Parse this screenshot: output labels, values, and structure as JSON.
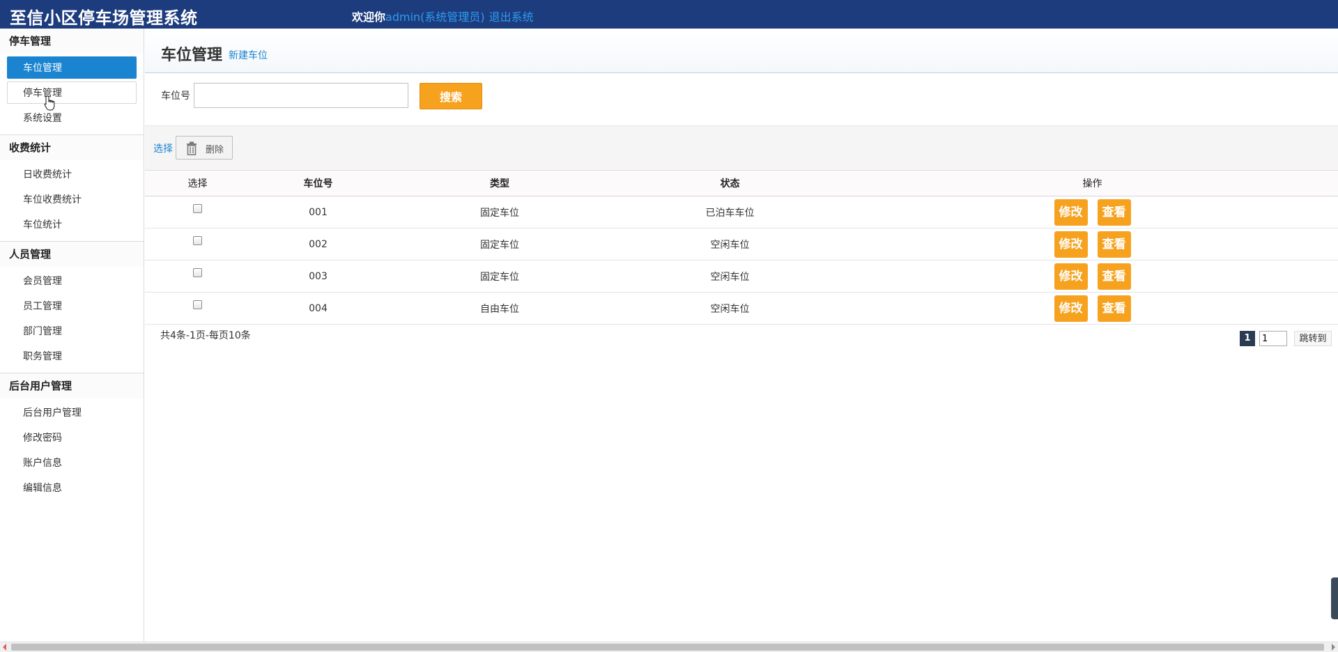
{
  "header": {
    "title": "至信小区停车场管理系统",
    "welcome": "欢迎你",
    "user": "admin(系统管理员)",
    "logout": "退出系统"
  },
  "sidebar": {
    "groups": [
      {
        "title": "停车管理",
        "items": [
          "车位管理",
          "停车管理",
          "系统设置"
        ]
      },
      {
        "title": "收费统计",
        "items": [
          "日收费统计",
          "车位收费统计",
          "车位统计"
        ]
      },
      {
        "title": "人员管理",
        "items": [
          "会员管理",
          "员工管理",
          "部门管理",
          "职务管理"
        ]
      },
      {
        "title": "后台用户管理",
        "items": [
          "后台用户管理",
          "修改密码",
          "账户信息",
          "编辑信息"
        ]
      }
    ],
    "active_item": "车位管理"
  },
  "page": {
    "title": "车位管理",
    "new_link": "新建车位"
  },
  "search": {
    "label": "车位号",
    "value": "",
    "button": "搜索"
  },
  "toolbar": {
    "select": "选择",
    "delete": "删除"
  },
  "table": {
    "headers": [
      "选择",
      "车位号",
      "类型",
      "状态",
      "操作"
    ],
    "rows": [
      {
        "id": "001",
        "type": "固定车位",
        "status": "已泊车车位"
      },
      {
        "id": "002",
        "type": "固定车位",
        "status": "空闲车位"
      },
      {
        "id": "003",
        "type": "固定车位",
        "status": "空闲车位"
      },
      {
        "id": "004",
        "type": "自由车位",
        "status": "空闲车位"
      }
    ],
    "edit_label": "修改",
    "view_label": "查看"
  },
  "pager": {
    "info": "共4条-1页-每页10条",
    "current": "1",
    "input_value": "1",
    "jump": "跳转到"
  },
  "colors": {
    "header_bg": "#1d3c7e",
    "accent": "#1a84d0",
    "button": "#f7a21f"
  }
}
